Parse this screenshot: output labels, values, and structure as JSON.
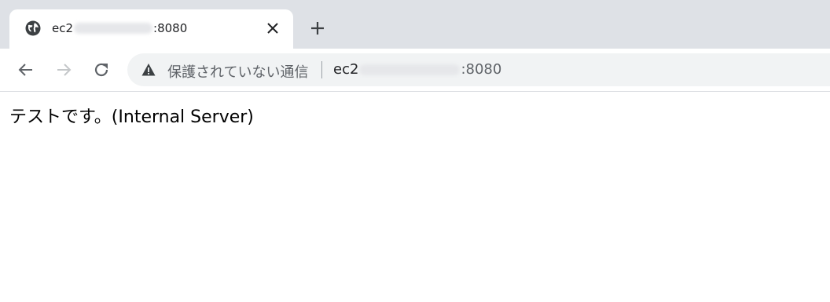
{
  "tab": {
    "title_prefix": "ec2",
    "title_suffix": ":8080",
    "favicon": "globe-icon",
    "close_icon": "close-icon"
  },
  "toolbar": {
    "back_icon": "arrow-left-icon",
    "forward_icon": "arrow-right-icon",
    "reload_icon": "reload-icon",
    "new_tab_icon": "plus-icon"
  },
  "omnibox": {
    "security_icon": "warning-triangle-icon",
    "security_text": "保護されていない通信",
    "url_prefix": "ec2",
    "url_suffix": ":8080"
  },
  "page": {
    "content_text": "テストです。(Internal Server)"
  },
  "colors": {
    "tabstrip_bg": "#dee1e6",
    "omnibox_bg": "#f1f3f4",
    "icon_gray": "#5f6368"
  }
}
